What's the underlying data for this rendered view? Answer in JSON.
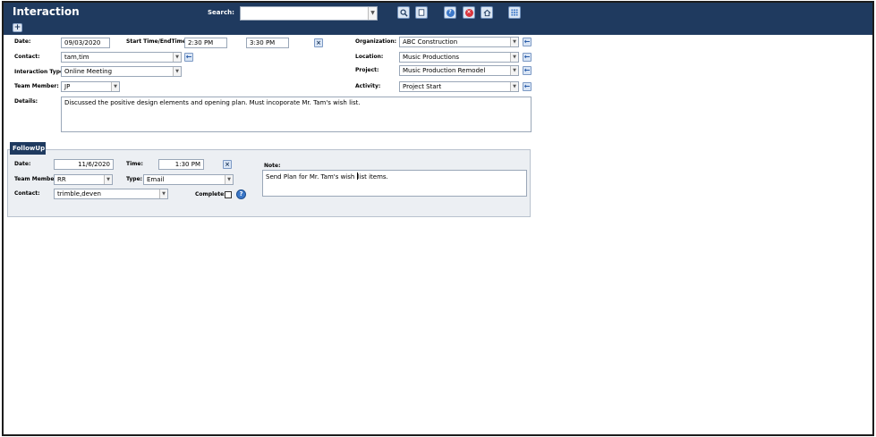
{
  "header": {
    "title": "Interaction",
    "search_label": "Search:",
    "search_value": ""
  },
  "main": {
    "date_label": "Date:",
    "date_value": "09/03/2020",
    "time_label": "Start Time/EndTime:",
    "start_time": "2:30 PM",
    "end_time": "3:30 PM",
    "contact_label": "Contact:",
    "contact_value": "tam,tim",
    "interaction_type_label": "Interaction Type:",
    "interaction_type_value": "Online Meeting",
    "team_member_label": "Team Member:",
    "team_member_value": "JP",
    "organization_label": "Organization:",
    "organization_value": "ABC Construction",
    "location_label": "Location:",
    "location_value": "Music Productions",
    "project_label": "Project:",
    "project_value": "Music Production Remodel",
    "activity_label": "Activity:",
    "activity_value": "Project Start",
    "details_label": "Details:",
    "details_value": "Discussed the positive design elements and opening plan.   Must incoporate Mr. Tam's wish list."
  },
  "followup": {
    "tab_label": "FollowUp",
    "date_label": "Date:",
    "date_value": "11/6/2020",
    "time_label": "Time:",
    "time_value": "1:30 PM",
    "team_member_label": "Team Member:",
    "team_member_value": "RR",
    "type_label": "Type:",
    "type_value": "Email",
    "contact_label": "Contact:",
    "contact_value": "trimble,deven",
    "complete_label": "Complete:",
    "note_label": "Note:",
    "note_before_cursor": "Send Plan for Mr. Tam's wish ",
    "note_after_cursor": "list items."
  },
  "icons": {
    "search": "search-icon",
    "form": "form-icon",
    "help": "help-icon",
    "close": "close-icon",
    "home": "home-icon",
    "menu": "grid-menu-icon",
    "clear": "clear-x-icon",
    "goto": "arrow-left-icon",
    "add": "plus-icon"
  },
  "colors": {
    "header_bg": "#1f3a5f",
    "followup_bg": "#eceff3",
    "help_blue": "#3b77c8",
    "close_red": "#d9363e"
  }
}
